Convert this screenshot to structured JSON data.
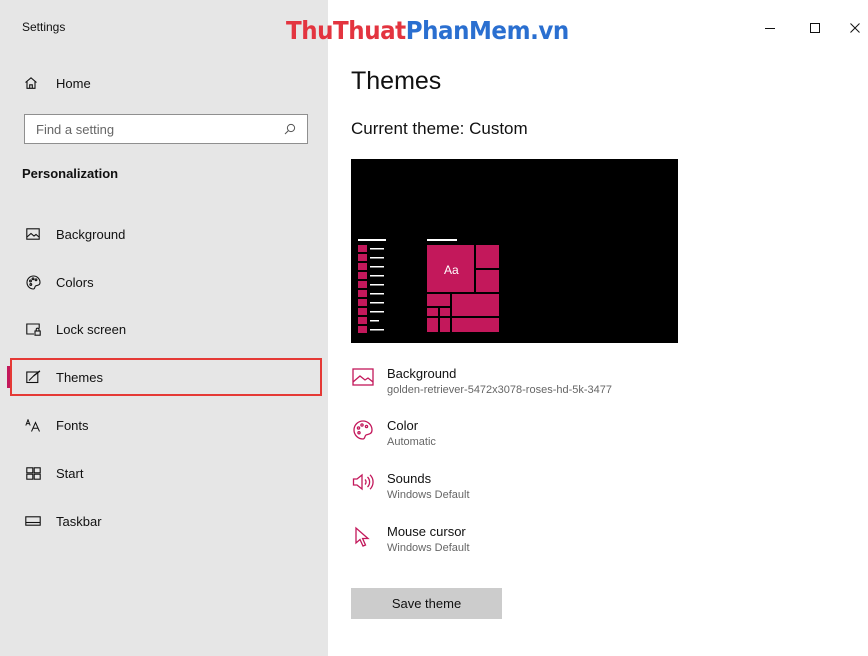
{
  "window": {
    "title": "Settings",
    "watermark_part1": "ThuThuat",
    "watermark_part2": "PhanMem.vn",
    "minimize_glyph": "−",
    "maximize_glyph": "☐",
    "close_glyph": "✕"
  },
  "sidebar": {
    "home_label": "Home",
    "search_placeholder": "Find a setting",
    "section_title": "Personalization",
    "items": [
      {
        "label": "Background",
        "icon": "picture-icon"
      },
      {
        "label": "Colors",
        "icon": "palette-icon"
      },
      {
        "label": "Lock screen",
        "icon": "lock-screen-icon"
      },
      {
        "label": "Themes",
        "icon": "themes-icon",
        "selected": true
      },
      {
        "label": "Fonts",
        "icon": "fonts-icon"
      },
      {
        "label": "Start",
        "icon": "start-icon"
      },
      {
        "label": "Taskbar",
        "icon": "taskbar-icon"
      }
    ]
  },
  "main": {
    "title": "Themes",
    "current_theme": "Current theme: Custom",
    "preview_tile_label": "Aa",
    "properties": [
      {
        "title": "Background",
        "value": "golden-retriever-5472x3078-roses-hd-5k-3477",
        "icon": "picture-icon"
      },
      {
        "title": "Color",
        "value": "Automatic",
        "icon": "palette-icon"
      },
      {
        "title": "Sounds",
        "value": "Windows Default",
        "icon": "speaker-icon"
      },
      {
        "title": "Mouse cursor",
        "value": "Windows Default",
        "icon": "cursor-icon"
      }
    ],
    "save_button": "Save theme"
  },
  "colors": {
    "accent": "#c3185b",
    "sidebar_bg": "#e6e6e6",
    "selection_outline": "#e53935"
  }
}
